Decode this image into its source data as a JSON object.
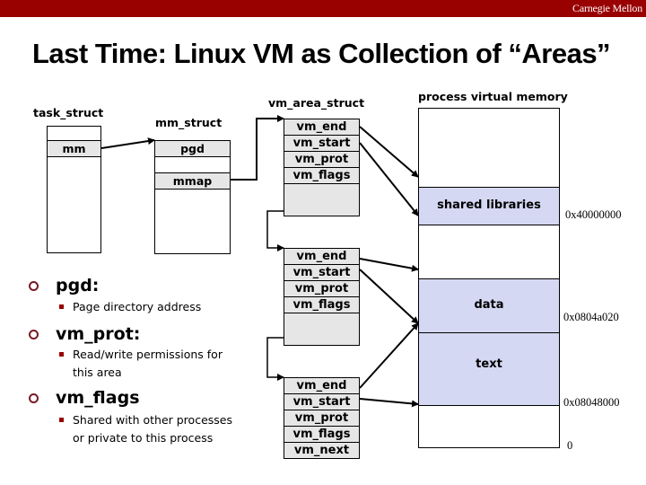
{
  "header": {
    "brand": "Carnegie Mellon",
    "title": "Last Time: Linux VM as Collection of “Areas”"
  },
  "diagram": {
    "task_struct": {
      "label": "task_struct",
      "fields": [
        "mm"
      ]
    },
    "mm_struct": {
      "label": "mm_struct",
      "fields": [
        "pgd",
        "mmap"
      ]
    },
    "vm_area_struct": {
      "label": "vm_area_struct",
      "areas": [
        {
          "fields": [
            "vm_end",
            "vm_start",
            "vm_prot",
            "vm_flags"
          ]
        },
        {
          "fields": [
            "vm_end",
            "vm_start",
            "vm_prot",
            "vm_flags"
          ]
        },
        {
          "fields": [
            "vm_end",
            "vm_start",
            "vm_prot",
            "vm_flags",
            "vm_next"
          ]
        }
      ]
    },
    "process_vm": {
      "label": "process virtual memory",
      "segments": [
        "shared libraries",
        "data",
        "text"
      ],
      "addresses": [
        "0x40000000",
        "0x0804a020",
        "0x08048000",
        "0"
      ]
    },
    "colors": {
      "accent": "#990000",
      "segment_fill": "#d5d8f2",
      "field_fill": "#e6e6e6"
    }
  },
  "notes": [
    {
      "term": "pgd:",
      "details": [
        "Page directory address"
      ]
    },
    {
      "term": "vm_prot:",
      "details": [
        "Read/write permissions for",
        "this area"
      ]
    },
    {
      "term": "vm_flags",
      "details": [
        "Shared with other processes",
        "or private to this process"
      ]
    }
  ]
}
